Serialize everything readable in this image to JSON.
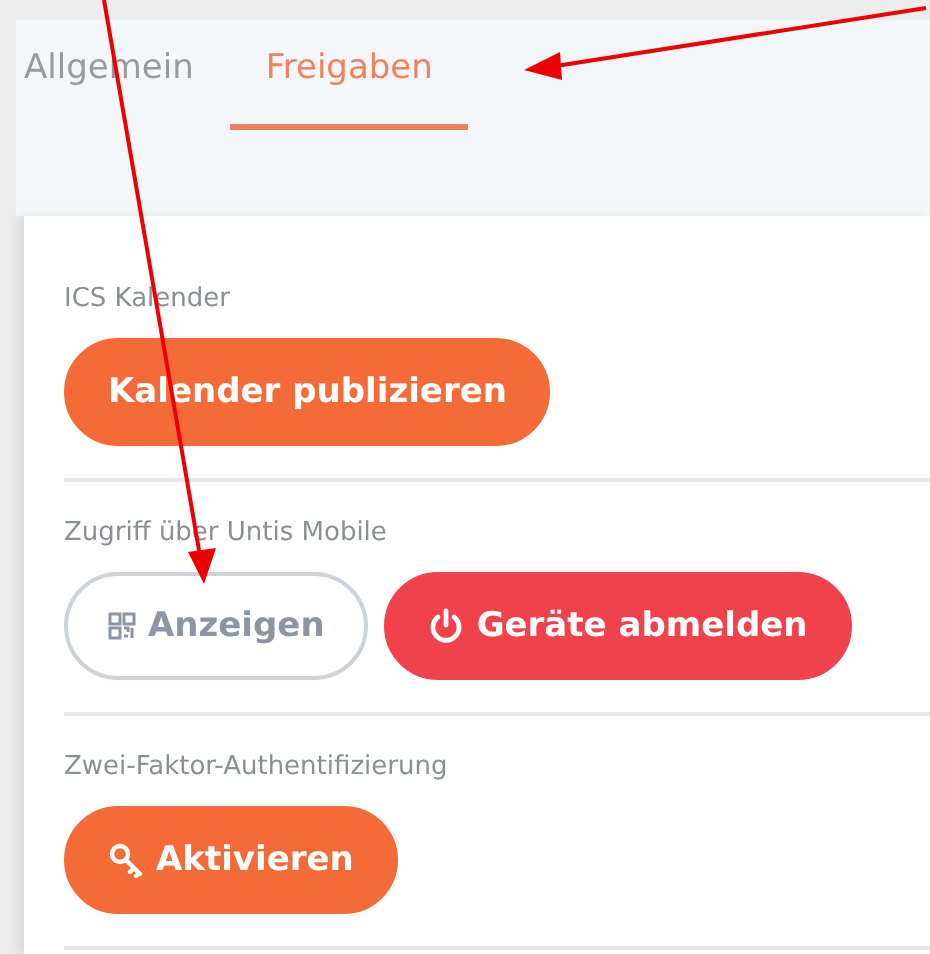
{
  "tabs": [
    {
      "label": "Allgemein",
      "selected": false
    },
    {
      "label": "Freigaben",
      "selected": true
    }
  ],
  "sections": [
    {
      "label": "ICS Kalender",
      "buttons": [
        {
          "label": "Kalender publizieren",
          "kind": "plain"
        }
      ]
    },
    {
      "label": "Zugriff über Untis Mobile",
      "buttons": [
        {
          "label": "Anzeigen",
          "kind": "qr"
        },
        {
          "label": "Geräte abmelden",
          "kind": "power"
        }
      ]
    },
    {
      "label": "Zwei-Faktor-Authentifizierung",
      "buttons": [
        {
          "label": "Aktivieren",
          "kind": "key"
        }
      ]
    }
  ]
}
